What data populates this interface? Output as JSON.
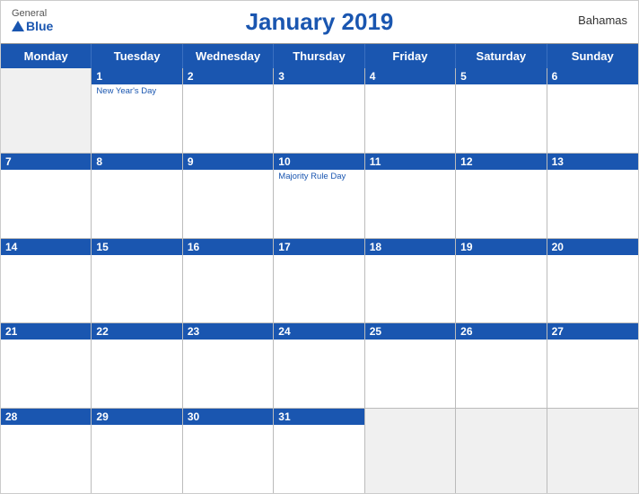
{
  "header": {
    "logo_general": "General",
    "logo_blue": "Blue",
    "title": "January 2019",
    "country": "Bahamas"
  },
  "days_of_week": [
    "Monday",
    "Tuesday",
    "Wednesday",
    "Thursday",
    "Friday",
    "Saturday",
    "Sunday"
  ],
  "weeks": [
    [
      {
        "day": "",
        "empty": true
      },
      {
        "day": "1",
        "holiday": "New Year's Day"
      },
      {
        "day": "2"
      },
      {
        "day": "3"
      },
      {
        "day": "4"
      },
      {
        "day": "5"
      },
      {
        "day": "6"
      }
    ],
    [
      {
        "day": "7"
      },
      {
        "day": "8"
      },
      {
        "day": "9"
      },
      {
        "day": "10",
        "holiday": "Majority Rule Day"
      },
      {
        "day": "11"
      },
      {
        "day": "12"
      },
      {
        "day": "13"
      }
    ],
    [
      {
        "day": "14"
      },
      {
        "day": "15"
      },
      {
        "day": "16"
      },
      {
        "day": "17"
      },
      {
        "day": "18"
      },
      {
        "day": "19"
      },
      {
        "day": "20"
      }
    ],
    [
      {
        "day": "21"
      },
      {
        "day": "22"
      },
      {
        "day": "23"
      },
      {
        "day": "24"
      },
      {
        "day": "25"
      },
      {
        "day": "26"
      },
      {
        "day": "27"
      }
    ],
    [
      {
        "day": "28"
      },
      {
        "day": "29"
      },
      {
        "day": "30"
      },
      {
        "day": "31"
      },
      {
        "day": "",
        "empty": true
      },
      {
        "day": "",
        "empty": true
      },
      {
        "day": "",
        "empty": true
      }
    ]
  ],
  "colors": {
    "blue": "#1a56b0",
    "light_blue_bg": "#e8eef8"
  }
}
